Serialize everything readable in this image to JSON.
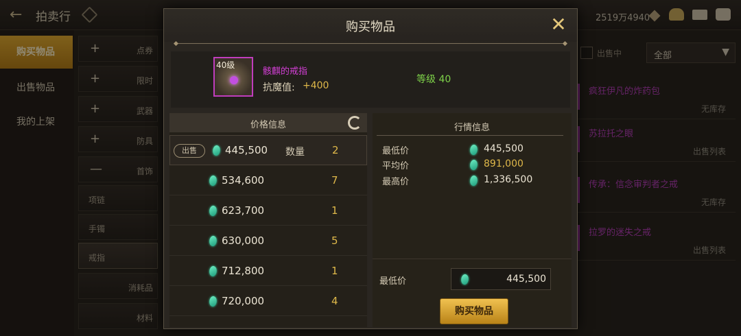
{
  "app": {
    "title": "拍卖行",
    "currency": "2519万4940"
  },
  "left_nav": [
    {
      "label": "购买物品",
      "active": true
    },
    {
      "label": "出售物品",
      "active": false
    },
    {
      "label": "我的上架",
      "active": false
    }
  ],
  "categories": [
    {
      "sign": "+",
      "label": "点券"
    },
    {
      "sign": "+",
      "label": "限时"
    },
    {
      "sign": "+",
      "label": "武器"
    },
    {
      "sign": "+",
      "label": "防具"
    },
    {
      "sign": "—",
      "label": "首饰"
    },
    {
      "sign": "",
      "label": "项链"
    },
    {
      "sign": "",
      "label": "手镯"
    },
    {
      "sign": "",
      "label": "戒指"
    },
    {
      "sign": "",
      "label": "消耗品"
    },
    {
      "sign": "",
      "label": "材料"
    }
  ],
  "right_list": {
    "checkbox_label": "出售中",
    "filter": "全部",
    "items": [
      {
        "name": "疯狂伊凡的炸药包",
        "status": "无库存"
      },
      {
        "name": "苏拉托之眼",
        "status": "出售列表"
      },
      {
        "name": "传承：信念审判者之戒",
        "status": "无库存"
      },
      {
        "name": "拉罗的迷失之戒",
        "status": "出售列表"
      }
    ]
  },
  "modal": {
    "title": "购买物品",
    "item": {
      "level_tag": "40级",
      "name": "骸麒的戒指",
      "stat_label": "抗魔值:",
      "stat_value": "+400",
      "level_text": "等级 40"
    },
    "price_panel": {
      "title": "价格信息",
      "sell_tag": "出售",
      "qty_label": "数量",
      "rows": [
        {
          "price": "445,500",
          "qty": "2"
        },
        {
          "price": "534,600",
          "qty": "7"
        },
        {
          "price": "623,700",
          "qty": "1"
        },
        {
          "price": "630,000",
          "qty": "5"
        },
        {
          "price": "712,800",
          "qty": "1"
        },
        {
          "price": "720,000",
          "qty": "4"
        }
      ]
    },
    "market_panel": {
      "title": "行情信息",
      "min_label": "最低价",
      "min_value": "445,500",
      "avg_label": "平均价",
      "avg_value": "891,000",
      "max_label": "最高价",
      "max_value": "1,336,500",
      "bottom_min_label": "最低价",
      "bottom_min_value": "445,500",
      "buy_button": "购买物品"
    },
    "colors": {
      "accent_gold": "#e0b94a",
      "item_purple": "#d43fd6",
      "level_green": "#7fd34a"
    }
  }
}
